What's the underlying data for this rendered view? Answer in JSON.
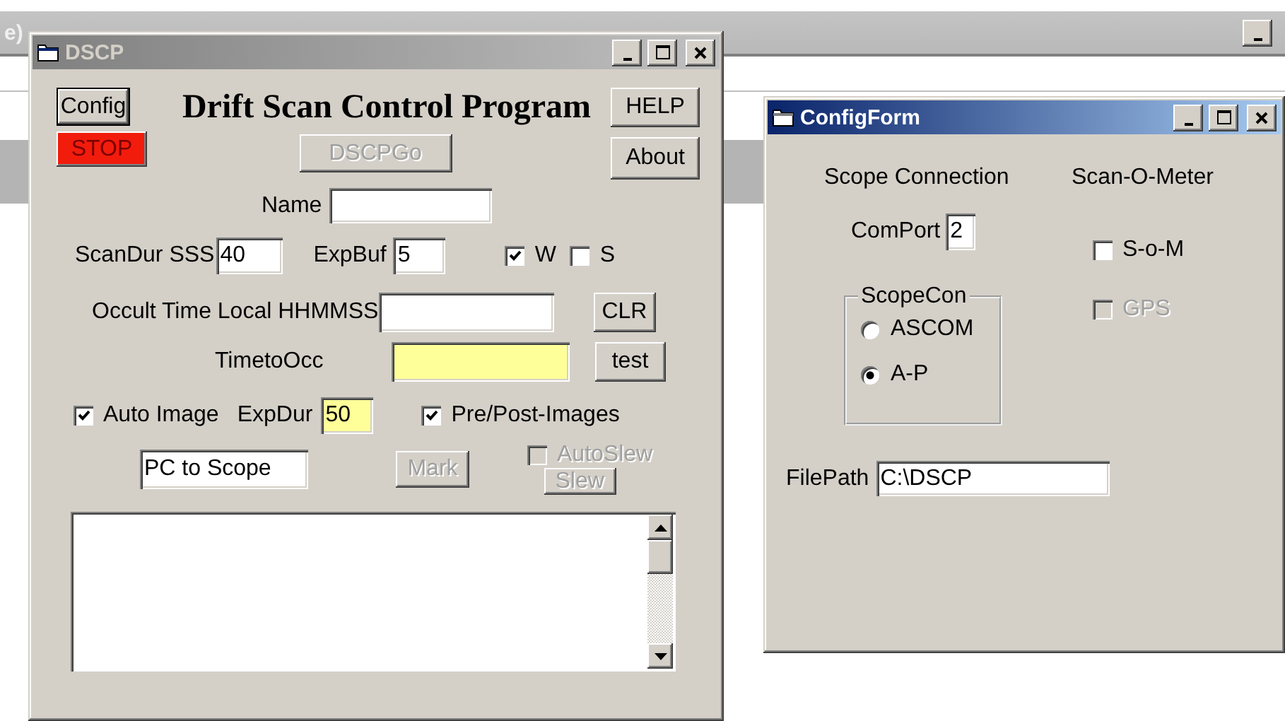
{
  "background_window": {
    "title": "e)",
    "active": false
  },
  "dscp_window": {
    "title": "DSCP",
    "active": false,
    "heading": "Drift Scan Control Program",
    "config_button": {
      "label": "Config",
      "focused": true,
      "disabled": false
    },
    "stop_button": {
      "label": "STOP",
      "focused": false,
      "disabled": false
    },
    "go_button": {
      "label": "DSCPGo",
      "focused": false,
      "disabled": true
    },
    "help_button": {
      "label": "HELP",
      "focused": false,
      "disabled": false
    },
    "about_button": {
      "label": "About",
      "focused": false,
      "disabled": false
    },
    "name_field": {
      "label": "Name",
      "highlighted": false
    },
    "scan_duration_field": {
      "label": "ScanDur SSS",
      "value": "40",
      "highlighted": false
    },
    "exposure_buffer_field": {
      "label": "ExpBuf",
      "value": "5",
      "highlighted": false
    },
    "w_checkbox": {
      "label": "W",
      "checked": true,
      "disabled": false
    },
    "s_checkbox": {
      "label": "S",
      "checked": false,
      "disabled": false
    },
    "occult_time_field": {
      "label": "Occult Time Local HHMMSS",
      "highlighted": false
    },
    "clr_button": {
      "label": "CLR",
      "focused": false,
      "disabled": false
    },
    "time_to_occ_field": {
      "label": "TimetoOcc",
      "highlighted": true
    },
    "test_button": {
      "label": "test",
      "focused": false,
      "disabled": false
    },
    "auto_image_checkbox": {
      "label": "Auto Image",
      "checked": true,
      "disabled": false
    },
    "exposure_duration_field": {
      "label": "ExpDur",
      "value": "50",
      "highlighted": true
    },
    "pre_post_checkbox": {
      "label": "Pre/Post-Images",
      "checked": true,
      "disabled": false
    },
    "mode_field": {
      "value": "PC to Scope",
      "highlighted": false
    },
    "mark_button": {
      "label": "Mark",
      "focused": false,
      "disabled": true
    },
    "autoslew_checkbox": {
      "label": "AutoSlew",
      "checked": false,
      "disabled": true
    },
    "slew_button": {
      "label": "Slew",
      "focused": false,
      "disabled": true
    }
  },
  "config_window": {
    "title": "ConfigForm",
    "active": true,
    "scope_heading": "Scope Connection",
    "meter_heading": "Scan-O-Meter",
    "com_port_field": {
      "label": "ComPort",
      "value": "2",
      "highlighted": false
    },
    "som_checkbox": {
      "label": "S-o-M",
      "checked": false,
      "disabled": false
    },
    "gps_checkbox": {
      "label": "GPS",
      "checked": false,
      "disabled": true
    },
    "scope_con_group": {
      "title": "ScopeCon",
      "options": [
        {
          "label": "ASCOM",
          "selected": false
        },
        {
          "label": "A-P",
          "selected": true
        }
      ]
    },
    "file_path_field": {
      "label": "FilePath",
      "value": "C:\\DSCP",
      "highlighted": false
    }
  }
}
